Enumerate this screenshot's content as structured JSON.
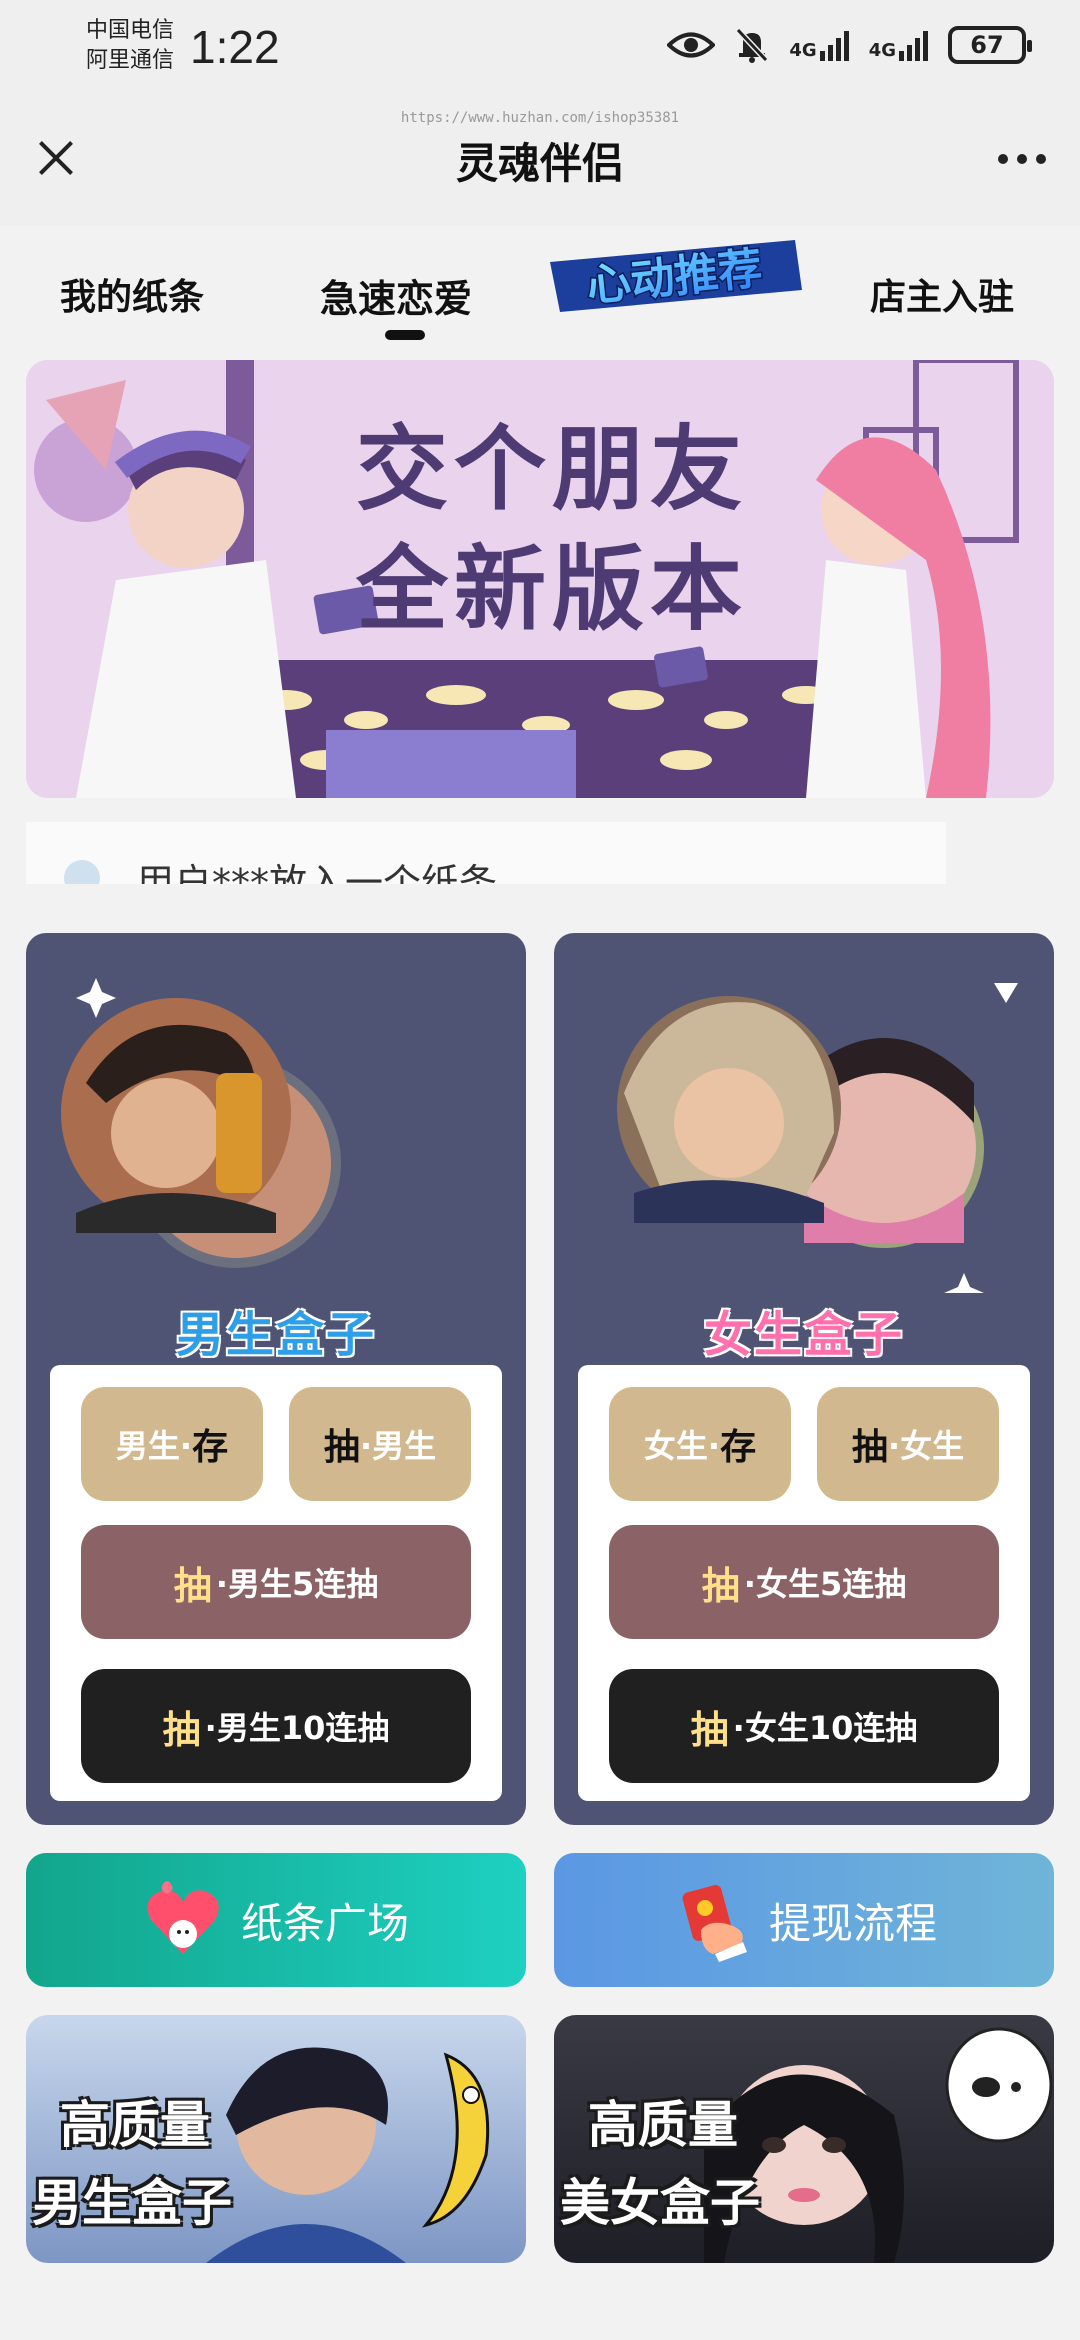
{
  "status": {
    "carrier_line1": "中国电信",
    "carrier_line2": "阿里通信",
    "time": "1:22",
    "net1": "4G",
    "net2": "4G",
    "battery": "67"
  },
  "header": {
    "title": "灵魂伴侣",
    "watermark_url": "https://www.huzhan.com/ishop35381"
  },
  "tabs": {
    "my_notes": "我的纸条",
    "speed_love": "急速恋爱",
    "hot_recommend": "心动推荐",
    "shop_join": "店主入驻"
  },
  "banner": {
    "line1": "交个朋友",
    "line2": "全新版本"
  },
  "notice": {
    "text": "用户***放入一个纸条"
  },
  "boy_box": {
    "title": "男生盒子",
    "store_label": "男生·",
    "store_action": "存",
    "draw_action": "抽",
    "draw_label": "·男生",
    "draw5_action": "抽",
    "draw5_label": "·男生5连抽",
    "draw10_action": "抽",
    "draw10_label": "·男生10连抽"
  },
  "girl_box": {
    "title": "女生盒子",
    "store_label": "女生·",
    "store_action": "存",
    "draw_action": "抽",
    "draw_label": "·女生",
    "draw5_action": "抽",
    "draw5_label": "·女生5连抽",
    "draw10_action": "抽",
    "draw10_label": "·女生10连抽"
  },
  "quick_links": {
    "square": "纸条广场",
    "withdraw": "提现流程"
  },
  "promos": {
    "boy_line1": "高质量",
    "boy_line2": "男生盒子",
    "girl_line1": "高质量",
    "girl_line2": "美女盒子"
  },
  "colors": {
    "card_bg": "#4f5475",
    "tan_button": "#d2b88e",
    "brown_button": "#8b6367",
    "black_button": "#202020",
    "square_gradient": [
      "#12a58c",
      "#1ed0c1"
    ],
    "withdraw_gradient": [
      "#5b97e4",
      "#6fb5d8"
    ]
  }
}
